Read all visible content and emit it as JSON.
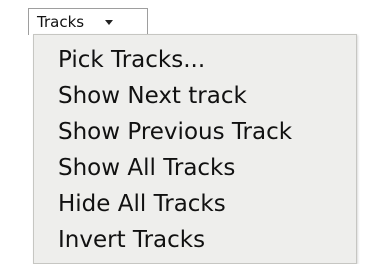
{
  "menu": {
    "title": "Tracks",
    "arrow_icon": "dropdown-arrow-icon",
    "items": [
      {
        "label": "Pick Tracks..."
      },
      {
        "label": "Show Next track"
      },
      {
        "label": "Show Previous Track"
      },
      {
        "label": "Show All Tracks"
      },
      {
        "label": "Hide All Tracks"
      },
      {
        "label": "Invert Tracks"
      }
    ]
  }
}
